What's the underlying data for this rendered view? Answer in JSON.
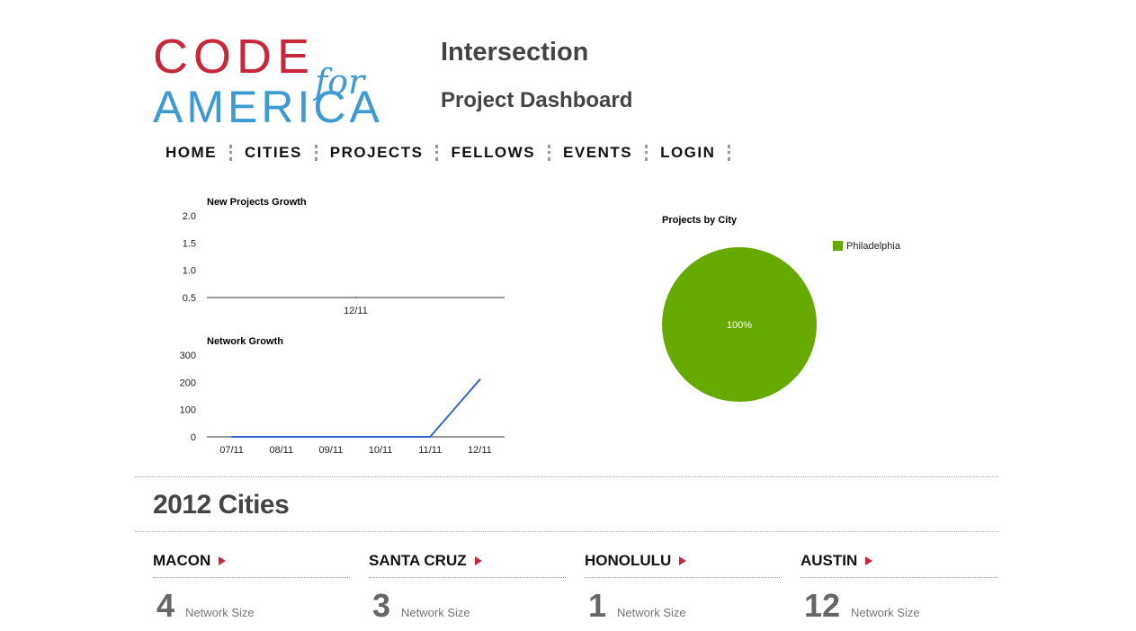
{
  "logo": {
    "line1": "CODE",
    "line2": "for",
    "line3": "AMERICA"
  },
  "header": {
    "title": "Intersection",
    "subtitle": "Project Dashboard"
  },
  "nav": {
    "items": [
      "HOME",
      "CITIES",
      "PROJECTS",
      "FELLOWS",
      "EVENTS",
      "LOGIN"
    ]
  },
  "chart_data": [
    {
      "type": "line",
      "title": "New Projects Growth",
      "x": [
        "12/11"
      ],
      "yticks": [
        2.0,
        1.5,
        1.0,
        0.5
      ],
      "ylim": [
        0.5,
        2.0
      ],
      "series": [
        {
          "values": [
            0.5
          ]
        }
      ],
      "color": "#3366cc"
    },
    {
      "type": "line",
      "title": "Network Growth",
      "x": [
        "07/11",
        "08/11",
        "09/11",
        "10/11",
        "11/11",
        "12/11"
      ],
      "yticks": [
        300,
        200,
        100,
        0
      ],
      "ylim": [
        0,
        300
      ],
      "series": [
        {
          "values": [
            0,
            0,
            0,
            0,
            0,
            210
          ]
        }
      ],
      "color": "#3366cc"
    },
    {
      "type": "pie",
      "title": "Projects by City",
      "legend_position": "right",
      "slices": [
        {
          "label": "Philadelphia",
          "value": 100,
          "color": "#66aa00",
          "display": "100%"
        }
      ]
    }
  ],
  "section": {
    "title": "2012 Cities"
  },
  "cities": [
    {
      "name": "MACON",
      "count": "4",
      "label": "Network Size"
    },
    {
      "name": "SANTA CRUZ",
      "count": "3",
      "label": "Network Size"
    },
    {
      "name": "HONOLULU",
      "count": "1",
      "label": "Network Size"
    },
    {
      "name": "AUSTIN",
      "count": "12",
      "label": "Network Size"
    }
  ],
  "colors": {
    "brand_red": "#c8283a",
    "brand_blue": "#3c9ad4",
    "line": "#3366cc",
    "pie": "#66aa00"
  }
}
